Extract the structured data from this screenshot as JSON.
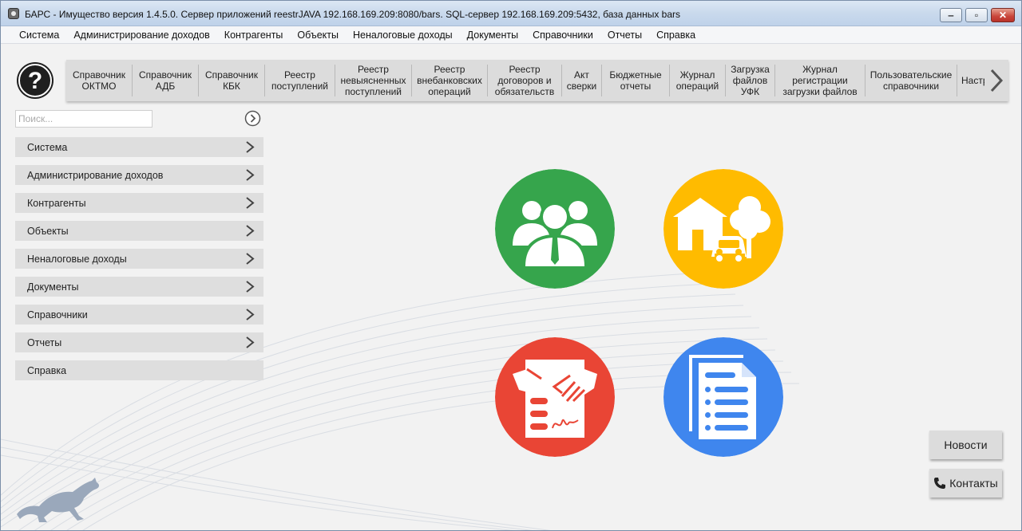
{
  "window": {
    "title": "БАРС - Имущество версия 1.4.5.0. Сервер приложений reestrJAVA 192.168.169.209:8080/bars. SQL-сервер 192.168.169.209:5432, база данных bars"
  },
  "menubar": [
    "Система",
    "Администрирование доходов",
    "Контрагенты",
    "Объекты",
    "Неналоговые доходы",
    "Документы",
    "Справочники",
    "Отчеты",
    "Справка"
  ],
  "toolbar": {
    "items": [
      "Справочник\nОКТМО",
      "Справочник\nАДБ",
      "Справочник\nКБК",
      "Реестр\nпоступлений",
      "Реестр\nневыясненных\nпоступлений",
      "Реестр\nвнебанковских\nопераций",
      "Реестр\nдоговоров и\nобязательств",
      "Акт\nсверки",
      "Бюджетные\nотчеты",
      "Журнал\nопераций",
      "Загрузка\nфайлов\nУФК",
      "Журнал\nрегистрации\nзагрузки файлов",
      "Пользовательские\nсправочники",
      "Настр"
    ]
  },
  "search": {
    "placeholder": "Поиск..."
  },
  "nav": [
    {
      "label": "Система",
      "has_arrow": true
    },
    {
      "label": "Администрирование доходов",
      "has_arrow": true
    },
    {
      "label": "Контрагенты",
      "has_arrow": true
    },
    {
      "label": "Объекты",
      "has_arrow": true
    },
    {
      "label": "Неналоговые доходы",
      "has_arrow": true
    },
    {
      "label": "Документы",
      "has_arrow": true
    },
    {
      "label": "Справочники",
      "has_arrow": true
    },
    {
      "label": "Отчеты",
      "has_arrow": true
    },
    {
      "label": "Справка",
      "has_arrow": false
    }
  ],
  "tiles": {
    "contractors": {
      "icon": "people-icon",
      "color": "#36a54c"
    },
    "objects": {
      "icon": "house-car-tree-icon",
      "color": "#ffbb00"
    },
    "contracts": {
      "icon": "handshake-contract-icon",
      "color": "#e94535"
    },
    "documents": {
      "icon": "documents-list-icon",
      "color": "#3f86ee"
    }
  },
  "buttons": {
    "news": "Новости",
    "contacts": "Контакты"
  }
}
